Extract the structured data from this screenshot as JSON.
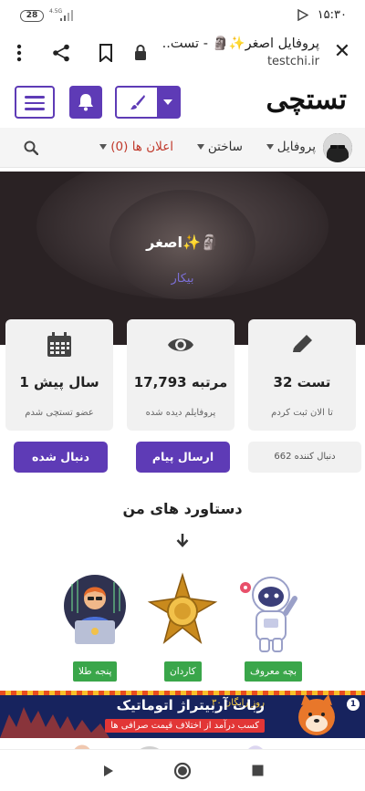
{
  "status_bar": {
    "battery": "28",
    "network": "4.5G",
    "time": "۱۵:۳۰"
  },
  "browser": {
    "page_title": "پروفایل اصغر✨🗿 - تست..",
    "domain": "testchi.ir"
  },
  "site": {
    "logo": "تستچی"
  },
  "nav": {
    "profile": "پروفایل",
    "create": "ساختن",
    "notifications": "اعلان ها (0)"
  },
  "profile": {
    "name": "اصغر✨🗿",
    "status": "بیکار"
  },
  "stats": [
    {
      "icon": "pencil-icon",
      "value": "32 تست",
      "caption": "تا الان ثبت کردم"
    },
    {
      "icon": "eye-icon",
      "value": "17,793 مرتبه",
      "caption": "پروفایلم دیده شده"
    },
    {
      "icon": "calendar-icon",
      "value": "1 سال پیش",
      "caption": "عضو تستچی شدم"
    }
  ],
  "actions": {
    "followers": "662 دنبال کننده",
    "message": "ارسال پیام",
    "following": "دنبال شده"
  },
  "achievements": {
    "title": "دستاورد های من",
    "badges": [
      {
        "label": "بچه معروف"
      },
      {
        "label": "کاردان"
      },
      {
        "label": "پنجه طلا"
      }
    ]
  },
  "ad": {
    "headline": "ربات آربیتراژ اتوماتیک",
    "sub": "کسب درآمد از اختلاف قیمت صرافی ها",
    "free": "۳۰ روز رایگان",
    "badge": "1"
  },
  "colors": {
    "brand_purple": "#5e3bb6",
    "badge_green": "#3aa64a",
    "nav_red": "#c0392b"
  }
}
